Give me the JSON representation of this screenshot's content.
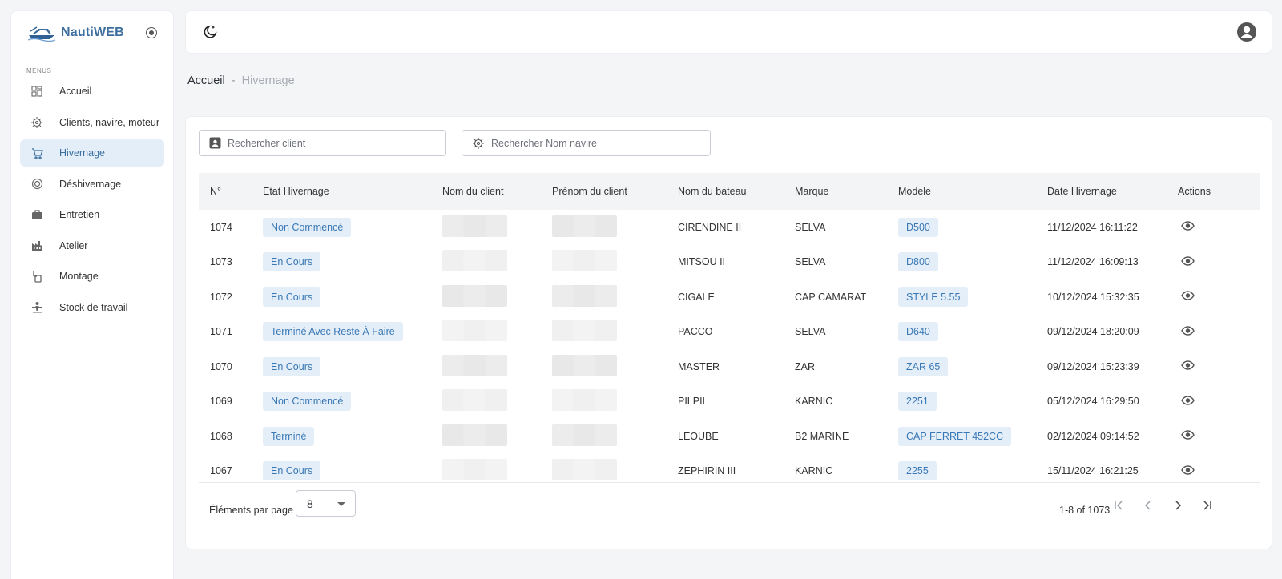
{
  "app": {
    "name": "NautiWEB"
  },
  "sidebar": {
    "menu_title": "MENUS",
    "items": [
      {
        "label": "Accueil",
        "icon": "dashboard-icon"
      },
      {
        "label": "Clients, navire, moteur",
        "icon": "helm-icon"
      },
      {
        "label": "Hivernage",
        "icon": "cart-icon",
        "active": true
      },
      {
        "label": "Déshivernage",
        "icon": "target-icon"
      },
      {
        "label": "Entretien",
        "icon": "briefcase-icon"
      },
      {
        "label": "Atelier",
        "icon": "factory-icon"
      },
      {
        "label": "Montage",
        "icon": "montage-icon"
      },
      {
        "label": "Stock de travail",
        "icon": "stock-icon"
      }
    ]
  },
  "breadcrumb": {
    "home": "Accueil",
    "separator": "-",
    "current": "Hivernage"
  },
  "search": {
    "client_placeholder": "Rechercher client",
    "navire_placeholder": "Rechercher Nom navire"
  },
  "table": {
    "columns": [
      "N°",
      "Etat Hivernage",
      "Nom du client",
      "Prénom du client",
      "Nom du bateau",
      "Marque",
      "Modele",
      "Date Hivernage",
      "Actions"
    ],
    "rows": [
      {
        "num": "1074",
        "etat": "Non Commencé",
        "bateau": "CIRENDINE II",
        "marque": "SELVA",
        "modele": "D500",
        "date": "11/12/2024 16:11:22"
      },
      {
        "num": "1073",
        "etat": "En Cours",
        "bateau": "MITSOU II",
        "marque": "SELVA",
        "modele": "D800",
        "date": "11/12/2024 16:09:13"
      },
      {
        "num": "1072",
        "etat": "En Cours",
        "bateau": "CIGALE",
        "marque": "CAP CAMARAT",
        "modele": "STYLE 5.55",
        "date": "10/12/2024 15:32:35"
      },
      {
        "num": "1071",
        "etat": "Terminé Avec Reste À Faire",
        "bateau": "PACCO",
        "marque": "SELVA",
        "modele": "D640",
        "date": "09/12/2024 18:20:09"
      },
      {
        "num": "1070",
        "etat": "En Cours",
        "bateau": "MASTER",
        "marque": "ZAR",
        "modele": "ZAR 65",
        "date": "09/12/2024 15:23:39"
      },
      {
        "num": "1069",
        "etat": "Non Commencé",
        "bateau": "PILPIL",
        "marque": "KARNIC",
        "modele": "2251",
        "date": "05/12/2024 16:29:50"
      },
      {
        "num": "1068",
        "etat": "Terminé",
        "bateau": "LEOUBE",
        "marque": "B2 MARINE",
        "modele": "CAP FERRET 452CC",
        "date": "02/12/2024 09:14:52"
      },
      {
        "num": "1067",
        "etat": "En Cours",
        "bateau": "ZEPHIRIN III",
        "marque": "KARNIC",
        "modele": "2255",
        "date": "15/11/2024 16:21:25"
      }
    ]
  },
  "pagination": {
    "per_page_label": "Éléments par page",
    "per_page_value": "8",
    "range_label": "1-8 of 1073"
  },
  "colors": {
    "accent": "#3a78b5",
    "chip_bg": "#e3eef9",
    "brand": "#3d6e9d"
  }
}
